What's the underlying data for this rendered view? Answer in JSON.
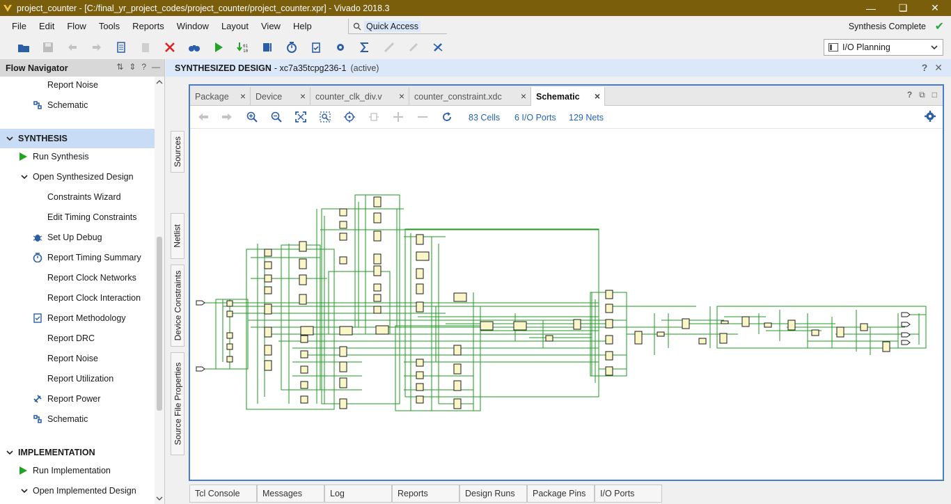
{
  "titlebar": {
    "title": "project_counter - [C:/final_yr_project_codes/project_counter/project_counter.xpr] - Vivado 2018.3",
    "controls": [
      "minimize-icon",
      "restore-icon",
      "close-icon"
    ]
  },
  "menu": {
    "items": [
      "File",
      "Edit",
      "Flow",
      "Tools",
      "Reports",
      "Window",
      "Layout",
      "View",
      "Help"
    ],
    "quick_access": "Quick Access",
    "status": "Synthesis Complete"
  },
  "toolbar": {
    "buttons": [
      "open-project-icon",
      "save-icon",
      "undo-icon",
      "redo-icon",
      "copy-icon",
      "paste-icon",
      "delete-icon",
      "binoculars-icon",
      "run-icon",
      "program-icon",
      "step-icon",
      "timer-icon",
      "checklist-icon",
      "settings-icon",
      "sigma-icon",
      "disabled-tool-icon",
      "disabled-edit-icon",
      "cancel-run-icon"
    ],
    "layout_selected": "I/O Planning"
  },
  "flow_navigator": {
    "title": "Flow Navigator",
    "items": [
      {
        "label": "Report Noise",
        "icon": "",
        "indent": 68,
        "bold": false
      },
      {
        "label": "Schematic",
        "icon": "schematic-icon",
        "indent": 68,
        "bold": false
      },
      {
        "label": "SYNTHESIS",
        "icon": "chevron-down-icon",
        "indent": 26,
        "bold": true,
        "section": true,
        "active": true
      },
      {
        "label": "Run Synthesis",
        "icon": "run-icon",
        "indent": 47,
        "bold": false
      },
      {
        "label": "Open Synthesized Design",
        "icon": "chevron-down-icon",
        "indent": 47,
        "bold": true
      },
      {
        "label": "Constraints Wizard",
        "icon": "",
        "indent": 68,
        "bold": false
      },
      {
        "label": "Edit Timing Constraints",
        "icon": "",
        "indent": 68,
        "bold": false
      },
      {
        "label": "Set Up Debug",
        "icon": "bug-icon",
        "indent": 68,
        "bold": false
      },
      {
        "label": "Report Timing Summary",
        "icon": "clock-icon",
        "indent": 68,
        "bold": false
      },
      {
        "label": "Report Clock Networks",
        "icon": "",
        "indent": 68,
        "bold": false
      },
      {
        "label": "Report Clock Interaction",
        "icon": "",
        "indent": 68,
        "bold": false
      },
      {
        "label": "Report Methodology",
        "icon": "checklist-icon",
        "indent": 68,
        "bold": false
      },
      {
        "label": "Report DRC",
        "icon": "",
        "indent": 68,
        "bold": false
      },
      {
        "label": "Report Noise",
        "icon": "",
        "indent": 68,
        "bold": false
      },
      {
        "label": "Report Utilization",
        "icon": "",
        "indent": 68,
        "bold": false
      },
      {
        "label": "Report Power",
        "icon": "power-icon",
        "indent": 68,
        "bold": false
      },
      {
        "label": "Schematic",
        "icon": "schematic-icon",
        "indent": 68,
        "bold": false
      },
      {
        "label": "",
        "icon": "",
        "indent": 0,
        "bold": false
      },
      {
        "label": "IMPLEMENTATION",
        "icon": "chevron-down-icon",
        "indent": 26,
        "bold": true,
        "section": true
      },
      {
        "label": "Run Implementation",
        "icon": "run-icon",
        "indent": 47,
        "bold": false
      },
      {
        "label": "Open Implemented Design",
        "icon": "chevron-down-icon",
        "indent": 47,
        "bold": true
      }
    ]
  },
  "side_tabs": [
    "Sources",
    "Netlist",
    "Device Constraints",
    "Source File Properties"
  ],
  "design": {
    "title": "SYNTHESIZED DESIGN",
    "part": "- xc7a35tcpg236-1",
    "state": "(active)"
  },
  "editor_tabs": [
    {
      "label": "Package",
      "active": false
    },
    {
      "label": "Device",
      "active": false
    },
    {
      "label": "counter_clk_div.v",
      "active": false
    },
    {
      "label": "counter_constraint.xdc",
      "active": false
    },
    {
      "label": "Schematic",
      "active": true
    }
  ],
  "schematic": {
    "cells": "83 Cells",
    "io_ports": "6 I/O Ports",
    "nets": "129 Nets",
    "tools": [
      "back-icon",
      "forward-icon",
      "zoom-in-icon",
      "zoom-out-icon",
      "fit-icon",
      "zoom-area-icon",
      "crosshair-icon",
      "route-icon",
      "add-icon",
      "remove-icon",
      "refresh-icon"
    ]
  },
  "bottom_tabs": [
    "Tcl Console",
    "Messages",
    "Log",
    "Reports",
    "Design Runs",
    "Package Pins",
    "I/O Ports"
  ],
  "colors": {
    "titlebar": "#7a5e0c",
    "accent": "#4a7dc9",
    "net": "#1f9a1f",
    "cell_fill": "#fbf6c8"
  }
}
